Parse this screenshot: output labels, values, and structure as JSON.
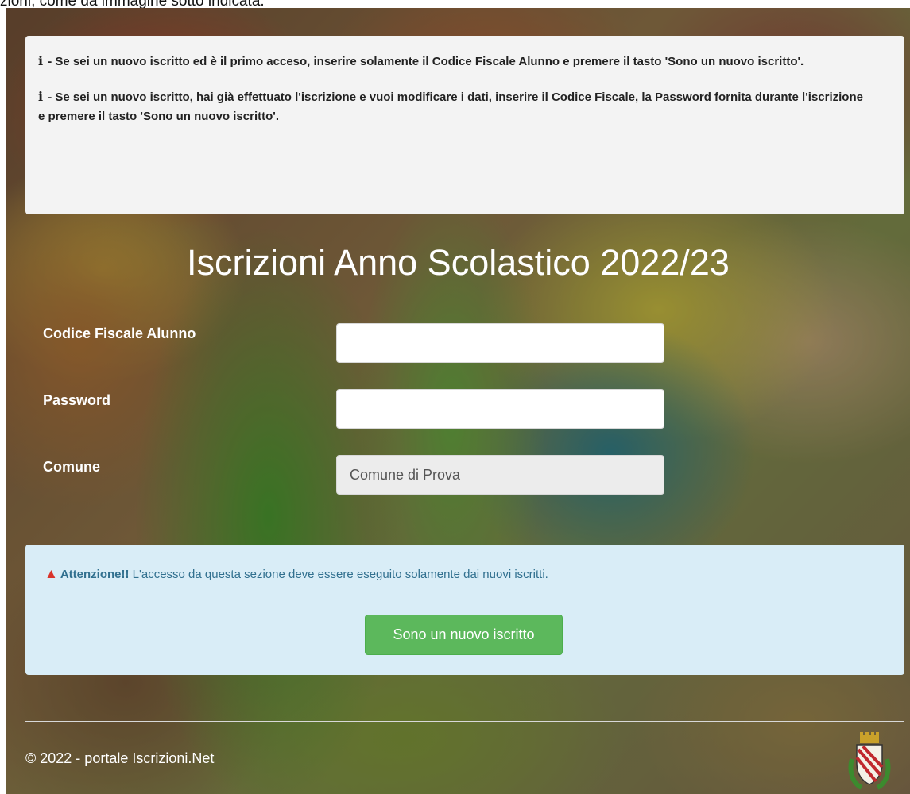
{
  "top_text": "zioni, come da immagine sotto indicata.",
  "info": {
    "icon": "info-icon",
    "lines": [
      "- Se sei un nuovo iscritto ed è il primo acceso, inserire solamente il Codice Fiscale Alunno e premere il tasto 'Sono un nuovo iscritto'.",
      "- Se sei un nuovo iscritto, hai già effettuato l'iscrizione e vuoi modificare i dati, inserire il Codice Fiscale, la Password fornita durante l'iscrizione e premere il tasto 'Sono un nuovo iscritto'."
    ],
    "icon_glyph": "i"
  },
  "title": "Iscrizioni Anno Scolastico 2022/23",
  "form": {
    "codice_fiscale_label": "Codice Fiscale Alunno",
    "codice_fiscale_value": "",
    "password_label": "Password",
    "password_value": "",
    "comune_label": "Comune",
    "comune_value": "Comune di Prova"
  },
  "alert": {
    "icon": "warning-icon",
    "strong": "Attenzione!!",
    "text": " L'accesso da questa sezione deve essere eseguito solamente dai nuovi iscritti.",
    "button_label": "Sono un nuovo iscritto"
  },
  "footer": {
    "text": "© 2022 - portale Iscrizioni.Net",
    "crest": "municipal-crest-icon"
  },
  "colors": {
    "alert_bg": "#d9edf7",
    "alert_text": "#31708f",
    "button_green": "#5cb85c",
    "warning_red": "#d9342b"
  }
}
